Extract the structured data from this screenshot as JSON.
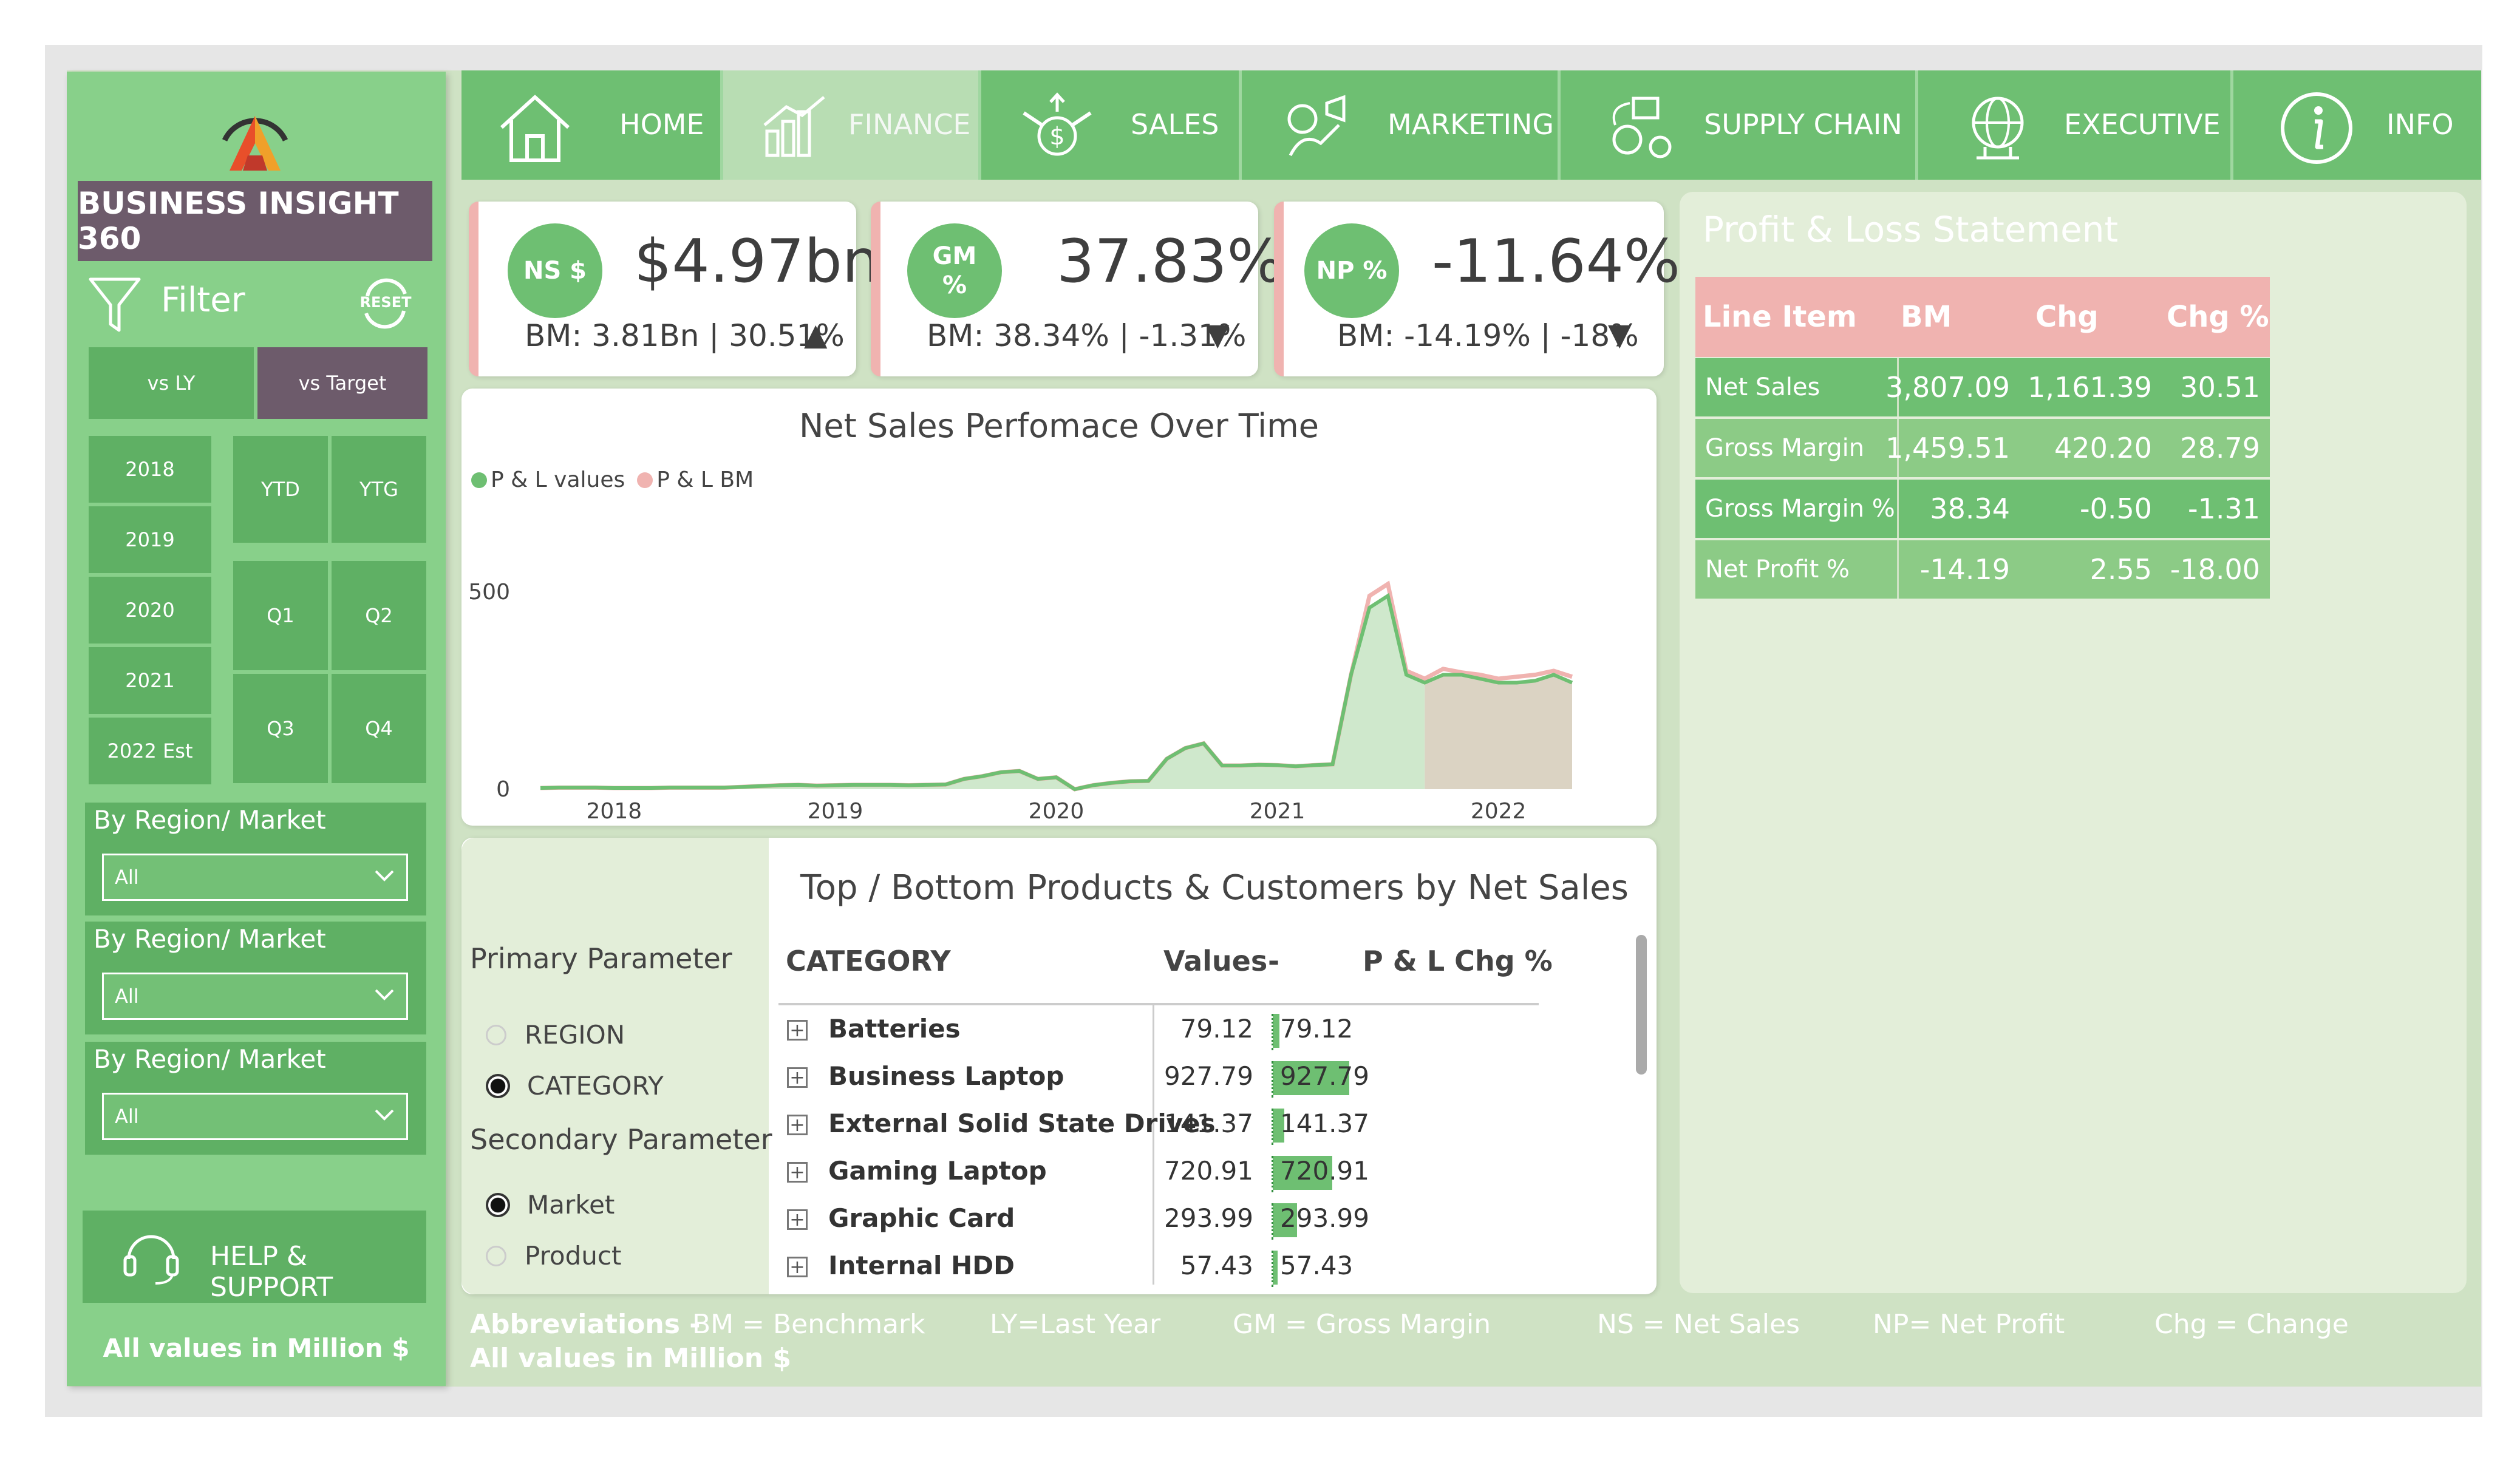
{
  "brand": {
    "title": "BUSINESS INSIGHT 360",
    "logo_icon": "atliq-logo-icon"
  },
  "filter": {
    "label": "Filter",
    "reset_label": "RESET",
    "toggle": [
      "vs LY",
      "vs Target"
    ],
    "years": [
      "2018",
      "2019",
      "2020",
      "2021",
      "2022 Est"
    ],
    "periods": {
      "ytd": "YTD",
      "ytg": "YTG",
      "q1": "Q1",
      "q2": "Q2",
      "q3": "Q3",
      "q4": "Q4"
    },
    "dropdowns": [
      {
        "label": "By Region/ Market",
        "value": "All"
      },
      {
        "label": "By Region/ Market",
        "value": "All"
      },
      {
        "label": "By Region/ Market",
        "value": "All"
      }
    ]
  },
  "help": {
    "label": "HELP & SUPPORT"
  },
  "sidebar_note": "All values in Million $",
  "nav": [
    {
      "label": "HOME",
      "icon": "home-icon"
    },
    {
      "label": "FINANCE",
      "icon": "finance-icon"
    },
    {
      "label": "SALES",
      "icon": "sales-icon"
    },
    {
      "label": "MARKETING",
      "icon": "marketing-icon"
    },
    {
      "label": "SUPPLY CHAIN",
      "icon": "supply-chain-icon"
    },
    {
      "label": "EXECUTIVE",
      "icon": "executive-icon"
    },
    {
      "label": "INFO",
      "icon": "info-icon"
    }
  ],
  "kpis": [
    {
      "badge": "NS $",
      "value": "$4.97bn",
      "sub": "BM: 3.81Bn | 30.51%",
      "trend": "▲"
    },
    {
      "badge_line1": "GM",
      "badge_line2": "%",
      "value": "37.83%",
      "sub": "BM: 38.34% | -1.31%",
      "trend": "▼"
    },
    {
      "badge": "NP %",
      "value": "-11.64%",
      "sub": "BM: -14.19% | -18%",
      "trend": "▼"
    }
  ],
  "pl": {
    "title": "Profit & Loss Statement",
    "headers": [
      "Line Item",
      "BM",
      "Chg",
      "Chg %"
    ],
    "rows": [
      {
        "item": "Net Sales",
        "bm": "3,807.09",
        "chg": "1,161.39",
        "pct": "30.51"
      },
      {
        "item": "Gross Margin",
        "bm": "1,459.51",
        "chg": "420.20",
        "pct": "28.79"
      },
      {
        "item": "Gross Margin %",
        "bm": "38.34",
        "chg": "-0.50",
        "pct": "-1.31"
      },
      {
        "item": "Net Profit %",
        "bm": "-14.19",
        "chg": "2.55",
        "pct": "-18.00"
      }
    ]
  },
  "chart_data": {
    "type": "area",
    "title": "Net Sales Perfomace Over Time",
    "series": [
      {
        "name": "P & L values",
        "color": "#6ebf72"
      },
      {
        "name": "P & L BM",
        "color": "#f0b3b0"
      }
    ],
    "x": [
      "2017-09",
      "2017-10",
      "2017-11",
      "2017-12",
      "2018-01",
      "2018-02",
      "2018-03",
      "2018-04",
      "2018-05",
      "2018-06",
      "2018-07",
      "2018-08",
      "2018-09",
      "2018-10",
      "2018-11",
      "2018-12",
      "2019-01",
      "2019-02",
      "2019-03",
      "2019-04",
      "2019-05",
      "2019-06",
      "2019-07",
      "2019-08",
      "2019-09",
      "2019-10",
      "2019-11",
      "2019-12",
      "2020-01",
      "2020-02",
      "2020-03",
      "2020-04",
      "2020-05",
      "2020-06",
      "2020-07",
      "2020-08",
      "2020-09",
      "2020-10",
      "2020-11",
      "2020-12",
      "2021-01",
      "2021-02",
      "2021-03",
      "2021-04",
      "2021-05",
      "2021-06",
      "2021-07",
      "2021-08",
      "2021-09",
      "2021-10",
      "2021-11",
      "2021-12",
      "2022-01",
      "2022-02",
      "2022-03",
      "2022-04",
      "2022-05",
      "2022-06",
      "2022-07",
      "2022-08"
    ],
    "values": [
      3,
      4,
      4,
      4,
      3,
      3,
      3,
      4,
      4,
      4,
      4,
      6,
      8,
      10,
      11,
      9,
      10,
      11,
      11,
      11,
      10,
      11,
      12,
      26,
      33,
      43,
      46,
      26,
      30,
      0,
      10,
      16,
      20,
      21,
      77,
      104,
      116,
      60,
      60,
      62,
      61,
      58,
      61,
      63,
      290,
      460,
      490,
      290,
      270,
      290,
      290,
      280,
      270,
      270,
      275,
      290,
      270,
      "",
      "",
      ""
    ],
    "bm_values": [
      3,
      4,
      4,
      4,
      3,
      3,
      3,
      4,
      4,
      4,
      4,
      6,
      8,
      10,
      11,
      9,
      10,
      11,
      11,
      11,
      10,
      11,
      12,
      26,
      33,
      43,
      46,
      26,
      30,
      0,
      10,
      16,
      20,
      21,
      77,
      104,
      116,
      60,
      60,
      62,
      61,
      58,
      61,
      63,
      290,
      490,
      520,
      300,
      280,
      305,
      296,
      290,
      280,
      285,
      290,
      300,
      285,
      "",
      "",
      ""
    ],
    "forecast_start": "2021-09",
    "x_ticks": [
      "2018",
      "2019",
      "2020",
      "2021",
      "2022"
    ],
    "y_ticks": [
      "0",
      "500"
    ],
    "ylim": [
      0,
      600
    ]
  },
  "products": {
    "title": "Top / Bottom Products & Customers by Net Sales",
    "primary_label": "Primary Parameter",
    "primary_options": [
      "REGION",
      "CATEGORY"
    ],
    "primary_selected": 1,
    "secondary_label": "Secondary Parameter",
    "secondary_options": [
      "Market",
      "Product"
    ],
    "secondary_selected": 0,
    "headers": [
      "CATEGORY",
      "Values",
      "-",
      "P & L Chg %"
    ],
    "rows": [
      {
        "name": "Batteries",
        "value": "79.12",
        "bar": "79.12",
        "v": 79.12
      },
      {
        "name": "Business Laptop",
        "value": "927.79",
        "bar": "927.79",
        "v": 927.79
      },
      {
        "name": "External Solid State Drives",
        "value": "141.37",
        "bar": "141.37",
        "v": 141.37
      },
      {
        "name": "Gaming Laptop",
        "value": "720.91",
        "bar": "720.91",
        "v": 720.91
      },
      {
        "name": "Graphic Card",
        "value": "293.99",
        "bar": "293.99",
        "v": 293.99
      },
      {
        "name": "Internal HDD",
        "value": "57.43",
        "bar": "57.43",
        "v": 57.43
      }
    ]
  },
  "footer": {
    "abbr_label": "Abbreviations -",
    "items": [
      "BM = Benchmark",
      "LY=Last Year",
      "GM = Gross Margin",
      "NS = Net Sales",
      "NP= Net Profit",
      "Chg = Change"
    ],
    "note": "All values in Million $"
  },
  "colors": {
    "green": "#6ebf72",
    "pink": "#f0b3b0",
    "purple": "#6d5b6b",
    "panel": "#e3eed9"
  }
}
